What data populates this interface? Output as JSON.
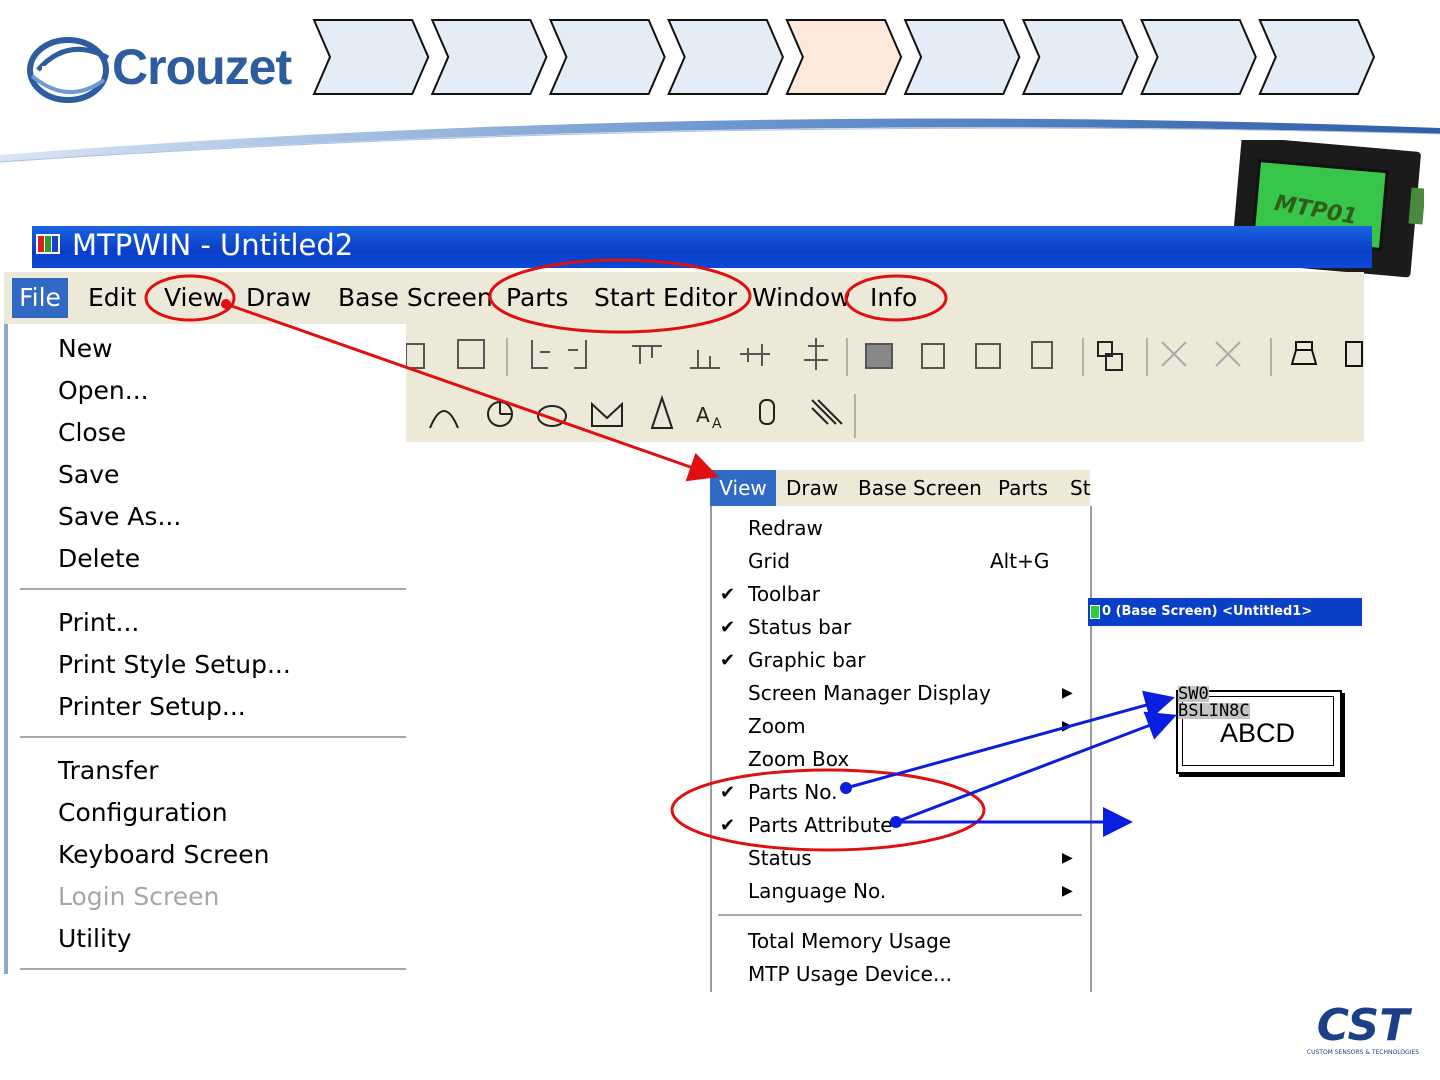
{
  "header": {
    "brand": "Crouzet",
    "chevron_count": 9,
    "highlighted_chevron": 5,
    "device_label": "MTP01"
  },
  "window": {
    "title": "MTPWIN - Untitled2"
  },
  "menubar": {
    "items": [
      "File",
      "Edit",
      "View",
      "Draw",
      "Base Screen",
      "Parts",
      "Start Editor",
      "Window",
      "Info"
    ]
  },
  "file_menu": {
    "group1": [
      "New",
      "Open...",
      "Close",
      "Save",
      "Save As...",
      "Delete"
    ],
    "group2": [
      "Print...",
      "Print Style Setup...",
      "Printer Setup..."
    ],
    "group3": [
      "Transfer",
      "Configuration",
      "Keyboard Screen",
      "Login Screen",
      "Utility"
    ],
    "disabled": [
      "Login Screen"
    ]
  },
  "view_menubar": {
    "items": [
      "View",
      "Draw",
      "Base Screen",
      "Parts",
      "St"
    ]
  },
  "view_menu": {
    "items": [
      {
        "label": "Redraw",
        "checked": false,
        "shortcut": "",
        "submenu": false
      },
      {
        "label": "Grid",
        "checked": false,
        "shortcut": "Alt+G",
        "submenu": false
      },
      {
        "label": "Toolbar",
        "checked": true,
        "shortcut": "",
        "submenu": false
      },
      {
        "label": "Status bar",
        "checked": true,
        "shortcut": "",
        "submenu": false
      },
      {
        "label": "Graphic bar",
        "checked": true,
        "shortcut": "",
        "submenu": false
      },
      {
        "label": "Screen Manager Display",
        "checked": false,
        "shortcut": "",
        "submenu": true
      },
      {
        "label": "Zoom",
        "checked": false,
        "shortcut": "",
        "submenu": true
      },
      {
        "label": "Zoom Box",
        "checked": false,
        "shortcut": "",
        "submenu": false
      },
      {
        "label": "Parts No.",
        "checked": true,
        "shortcut": "",
        "submenu": false
      },
      {
        "label": "Parts Attribute",
        "checked": true,
        "shortcut": "",
        "submenu": false
      },
      {
        "label": "Status",
        "checked": false,
        "shortcut": "",
        "submenu": true
      },
      {
        "label": "Language No.",
        "checked": false,
        "shortcut": "",
        "submenu": true
      },
      {
        "label": "Total Memory Usage",
        "checked": false,
        "shortcut": "",
        "submenu": false
      },
      {
        "label": "MTP Usage Device...",
        "checked": false,
        "shortcut": "",
        "submenu": false
      }
    ]
  },
  "base_screen": {
    "title": "0 (Base Screen) <Untitled1>"
  },
  "part_preview": {
    "part_no": "SW0",
    "attribute": "BSLIN8C",
    "label": "ABCD"
  },
  "footer": {
    "logo": "CST",
    "tagline": "CUSTOM SENSORS & TECHNOLOGIES"
  },
  "colors": {
    "title_bar": "#0a3fc8",
    "menu_highlight": "#316ac5",
    "annotation_red": "#e01010",
    "annotation_blue": "#0a1ee0",
    "chevron_active": "#fde8dc",
    "chevron_inactive": "#e4ecf8"
  }
}
